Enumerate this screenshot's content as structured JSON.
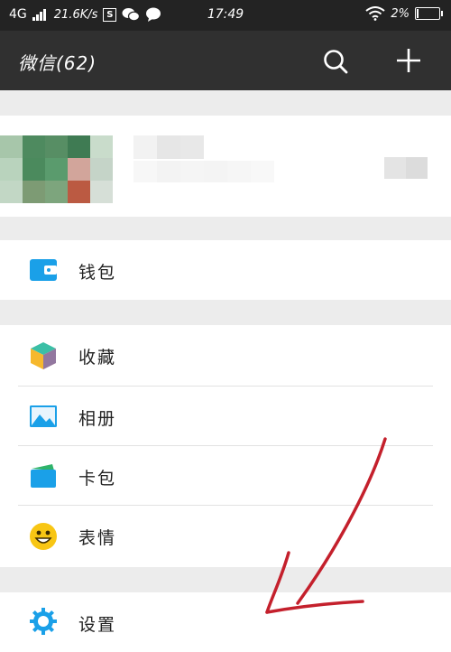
{
  "status_bar": {
    "network": "4G",
    "speed": "21.6K/s",
    "s_icon_label": "S",
    "time": "17:49",
    "battery": "2%"
  },
  "header": {
    "title": "微信(62)",
    "icons": [
      "search-icon",
      "plus-icon"
    ]
  },
  "menu": {
    "wallet": "钱包",
    "favorites": "收藏",
    "album": "相册",
    "cards": "卡包",
    "stickers": "表情",
    "settings": "设置"
  },
  "colors": {
    "header_bg": "#303030",
    "status_bg": "#232323",
    "accent_blue": "#1aa0e8",
    "annotation_red": "#c4202c"
  }
}
